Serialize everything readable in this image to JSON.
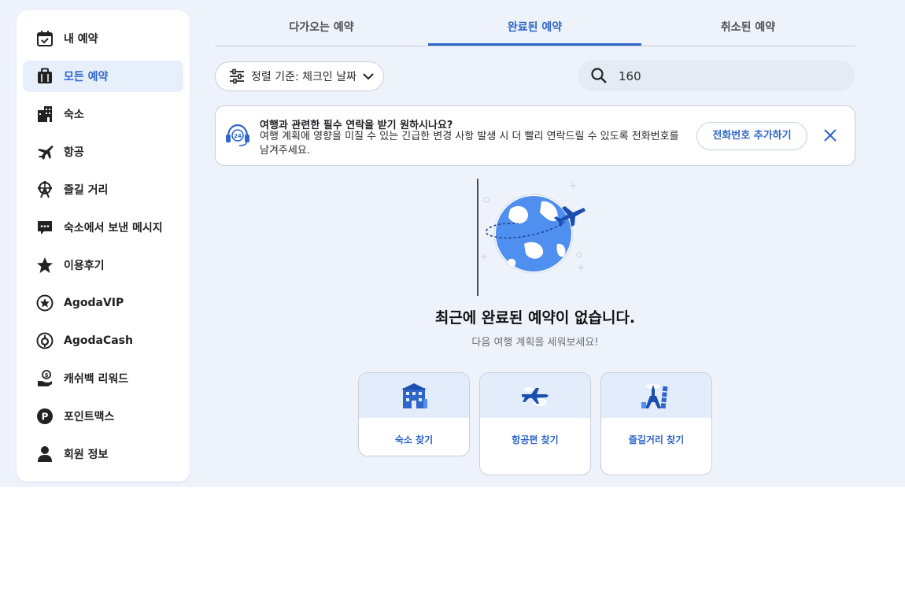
{
  "sidebar": {
    "items": [
      {
        "label": "내 예약",
        "icon": "calendar-check-icon"
      },
      {
        "label": "모든 예약",
        "icon": "suitcase-icon",
        "active": true
      },
      {
        "label": "숙소",
        "icon": "building-icon"
      },
      {
        "label": "항공",
        "icon": "airplane-icon"
      },
      {
        "label": "즐길 거리",
        "icon": "ferris-wheel-icon"
      },
      {
        "label": "숙소에서 보낸 메시지",
        "icon": "chat-bubble-icon"
      },
      {
        "label": "이용후기",
        "icon": "star-icon"
      },
      {
        "label": "AgodaVIP",
        "icon": "vip-star-icon"
      },
      {
        "label": "AgodaCash",
        "icon": "cash-icon"
      },
      {
        "label": "캐쉬백 리워드",
        "icon": "cashback-hand-icon"
      },
      {
        "label": "포인트맥스",
        "icon": "points-icon"
      },
      {
        "label": "회원 정보",
        "icon": "user-icon"
      }
    ]
  },
  "tabs": [
    {
      "label": "다가오는 예약"
    },
    {
      "label": "완료된 예약",
      "active": true
    },
    {
      "label": "취소된 예약"
    }
  ],
  "sort": {
    "label": "정렬 기준: 체크인 날짜"
  },
  "search": {
    "value": "160"
  },
  "banner": {
    "title": "여행과 관련한 필수 연락을 받기 원하시나요?",
    "body": "여행 계획에 영향을 미칠 수 있는 긴급한 변경 사항 발생 시 더 빨리 연락드릴 수 있도록 전화번호를 남겨주세요.",
    "button": "전화번호 추가하기"
  },
  "empty": {
    "title": "최근에 완료된 예약이 없습니다.",
    "subtitle": "다음 여행 계획을 세워보세요!"
  },
  "cards": [
    {
      "label": "숙소 찾기",
      "icon": "hotel-building-icon"
    },
    {
      "label": "항공편 찾기",
      "icon": "plane-cloud-icon"
    },
    {
      "label": "즐길거리 찾기",
      "icon": "landmarks-icon"
    }
  ],
  "colors": {
    "accent": "#2f66c9",
    "background": "#eef3fb",
    "globe": "#4f8ff0"
  }
}
